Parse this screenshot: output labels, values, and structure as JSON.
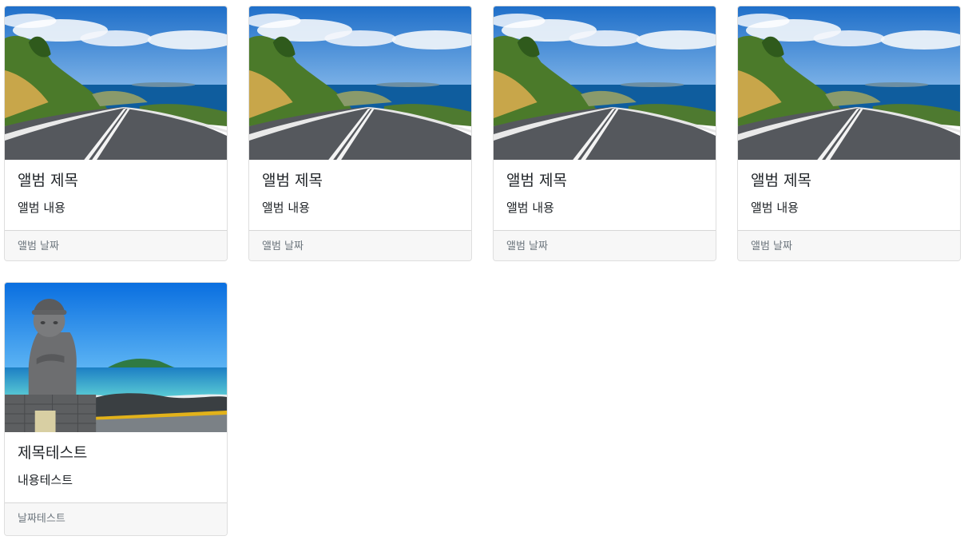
{
  "cards": [
    {
      "title": "앨범 제목",
      "text": "앨범 내용",
      "date": "앨범 날짜",
      "image": "coastal-road-photo"
    },
    {
      "title": "앨범 제목",
      "text": "앨범 내용",
      "date": "앨범 날짜",
      "image": "coastal-road-photo"
    },
    {
      "title": "앨범 제목",
      "text": "앨범 내용",
      "date": "앨범 날짜",
      "image": "coastal-road-photo"
    },
    {
      "title": "앨범 제목",
      "text": "앨범 내용",
      "date": "앨범 날짜",
      "image": "coastal-road-photo"
    },
    {
      "title": "제목테스트",
      "text": "내용테스트",
      "date": "날짜테스트",
      "image": "jeju-stone-statue-beach-photo"
    }
  ],
  "colors": {
    "card_border": "#dcdcdc",
    "footer_bg": "#f7f7f7",
    "muted_text": "#6c757d",
    "text": "#212529"
  }
}
